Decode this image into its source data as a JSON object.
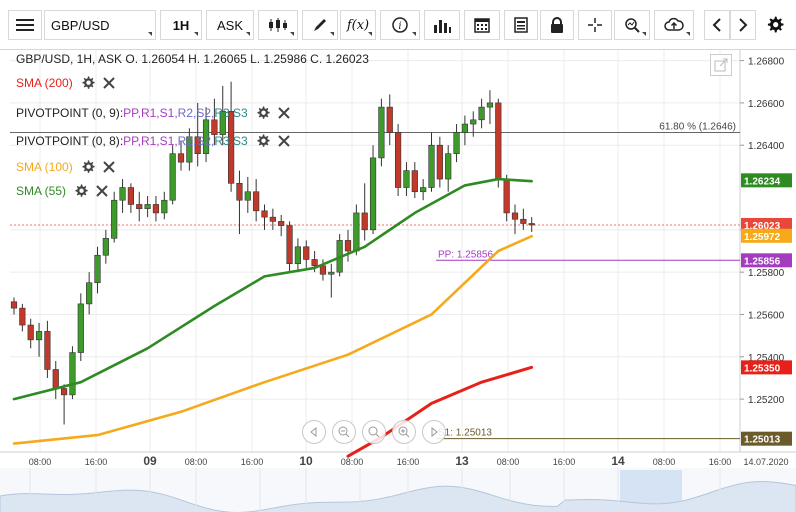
{
  "toolbar": {
    "menu_icon": "hamburger-icon",
    "symbol": "GBP/USD",
    "timeframe": "1H",
    "price_side": "ASK",
    "tools": [
      "candlestick-type-icon",
      "draw-pen-icon",
      "function-fx-icon",
      "info-icon",
      "bar-chart-icon",
      "calendar-icon",
      "news-doc-icon",
      "lock-icon",
      "crosshair-icon",
      "zoom-search-icon",
      "cloud-upload-icon",
      "chevron-left-icon",
      "chevron-right-icon",
      "gear-icon"
    ]
  },
  "ohlc_line": "GBP/USD, 1H, ASK   O. 1.26054 H. 1.26065 L. 1.25986 C. 1.26023",
  "indicators": [
    {
      "label": "SMA (200)",
      "color": "#e8201a"
    },
    {
      "label": "PIVOTPOINT (0, 9)",
      "color": "#222222",
      "levels": [
        "PP",
        "R1",
        "S1",
        "R2",
        "S2",
        "R3",
        "S3"
      ]
    },
    {
      "label": "PIVOTPOINT (0, 8)",
      "color": "#222222",
      "levels": [
        "PP",
        "R1",
        "S1",
        "R2",
        "S2",
        "R3",
        "S3"
      ]
    },
    {
      "label": "SMA (100)",
      "color": "#f5a91b"
    },
    {
      "label": "SMA (55)",
      "color": "#2e8b22"
    }
  ],
  "level_colors": {
    "PP": "#a43cc0",
    "R1": "#a43cc0",
    "S1": "#a43cc0",
    "R2": "#6b6bd0",
    "S2": "#6b6bd0",
    "R3": "#2a8a8a",
    "S3": "#2a8a8a"
  },
  "annotations": {
    "fib": "61.80 % (1.2646)",
    "pp": "PP: 1.25856",
    "s1": "S1: 1.25013"
  },
  "price_axis": {
    "ticks": [
      "1.26800",
      "1.26600",
      "1.26400",
      "1.26000",
      "1.25800",
      "1.25600",
      "1.25400",
      "1.25200"
    ],
    "badges": [
      {
        "text": "1.26234",
        "color": "#2e8b22",
        "value": 1.26234
      },
      {
        "text": "1.26023",
        "color": "#e8473a",
        "value": 1.26023
      },
      {
        "text": "1.25972",
        "color": "#f5a91b",
        "value": 1.25972
      },
      {
        "text": "1.25856",
        "color": "#a43cc0",
        "value": 1.25856
      },
      {
        "text": "1.25350",
        "color": "#e8201a",
        "value": 1.2535
      },
      {
        "text": "1.25013",
        "color": "#6b5a2a",
        "value": 1.25013
      }
    ]
  },
  "time_axis": [
    "08:00",
    "16:00",
    "09",
    "08:00",
    "16:00",
    "10",
    "08:00",
    "16:00",
    "13",
    "08:00",
    "16:00",
    "14",
    "08:00",
    "16:00",
    "14.07.2020"
  ],
  "chart_data": {
    "type": "candlestick",
    "ylim": [
      1.2495,
      1.2685
    ],
    "candles": [
      [
        1.2566,
        1.2568,
        1.256,
        1.2563
      ],
      [
        1.2563,
        1.2565,
        1.2552,
        1.2555
      ],
      [
        1.2555,
        1.2558,
        1.2544,
        1.2548
      ],
      [
        1.2548,
        1.2556,
        1.254,
        1.2552
      ],
      [
        1.2552,
        1.2557,
        1.253,
        1.2534
      ],
      [
        1.2534,
        1.2538,
        1.252,
        1.2525
      ],
      [
        1.2525,
        1.2527,
        1.2508,
        1.2522
      ],
      [
        1.2522,
        1.2545,
        1.252,
        1.2542
      ],
      [
        1.2542,
        1.257,
        1.2538,
        1.2565
      ],
      [
        1.2565,
        1.258,
        1.256,
        1.2575
      ],
      [
        1.2575,
        1.2592,
        1.257,
        1.2588
      ],
      [
        1.2588,
        1.26,
        1.2584,
        1.2596
      ],
      [
        1.2596,
        1.2618,
        1.2594,
        1.2614
      ],
      [
        1.2614,
        1.2624,
        1.2608,
        1.262
      ],
      [
        1.262,
        1.2622,
        1.2608,
        1.2612
      ],
      [
        1.2612,
        1.2618,
        1.2604,
        1.261
      ],
      [
        1.261,
        1.2616,
        1.2606,
        1.2612
      ],
      [
        1.2612,
        1.2616,
        1.2604,
        1.2608
      ],
      [
        1.2608,
        1.2618,
        1.2605,
        1.2614
      ],
      [
        1.2614,
        1.264,
        1.2612,
        1.2636
      ],
      [
        1.2636,
        1.2642,
        1.2628,
        1.2632
      ],
      [
        1.2632,
        1.2648,
        1.2628,
        1.2644
      ],
      [
        1.2644,
        1.266,
        1.263,
        1.2636
      ],
      [
        1.2636,
        1.2658,
        1.2632,
        1.2652
      ],
      [
        1.2652,
        1.2662,
        1.264,
        1.2645
      ],
      [
        1.2645,
        1.2668,
        1.264,
        1.2656
      ],
      [
        1.2656,
        1.267,
        1.2618,
        1.2622
      ],
      [
        1.2622,
        1.2628,
        1.2598,
        1.2614
      ],
      [
        1.2614,
        1.2625,
        1.2608,
        1.2618
      ],
      [
        1.2618,
        1.2624,
        1.2604,
        1.2609
      ],
      [
        1.2609,
        1.2612,
        1.26,
        1.2606
      ],
      [
        1.2606,
        1.261,
        1.26,
        1.2604
      ],
      [
        1.2604,
        1.2607,
        1.2597,
        1.2602
      ],
      [
        1.2602,
        1.2604,
        1.258,
        1.2584
      ],
      [
        1.2584,
        1.2596,
        1.258,
        1.2592
      ],
      [
        1.2592,
        1.2595,
        1.2582,
        1.2586
      ],
      [
        1.2586,
        1.259,
        1.258,
        1.2583
      ],
      [
        1.2583,
        1.2586,
        1.2576,
        1.2579
      ],
      [
        1.2579,
        1.2584,
        1.2568,
        1.258
      ],
      [
        1.258,
        1.2598,
        1.2578,
        1.2595
      ],
      [
        1.2595,
        1.26,
        1.2585,
        1.259
      ],
      [
        1.259,
        1.2612,
        1.2588,
        1.2608
      ],
      [
        1.2608,
        1.2622,
        1.2595,
        1.26
      ],
      [
        1.26,
        1.264,
        1.2598,
        1.2634
      ],
      [
        1.2634,
        1.2662,
        1.263,
        1.2658
      ],
      [
        1.2658,
        1.2664,
        1.264,
        1.2646
      ],
      [
        1.2646,
        1.265,
        1.2616,
        1.262
      ],
      [
        1.262,
        1.2632,
        1.2616,
        1.2628
      ],
      [
        1.2628,
        1.2632,
        1.2615,
        1.2618
      ],
      [
        1.2618,
        1.2624,
        1.2614,
        1.262
      ],
      [
        1.262,
        1.2646,
        1.2618,
        1.264
      ],
      [
        1.264,
        1.2644,
        1.262,
        1.2624
      ],
      [
        1.2624,
        1.264,
        1.2618,
        1.2636
      ],
      [
        1.2636,
        1.265,
        1.2632,
        1.2646
      ],
      [
        1.2646,
        1.2654,
        1.264,
        1.265
      ],
      [
        1.265,
        1.2656,
        1.2644,
        1.2652
      ],
      [
        1.2652,
        1.2662,
        1.2648,
        1.2658
      ],
      [
        1.2658,
        1.2666,
        1.265,
        1.266
      ],
      [
        1.266,
        1.2662,
        1.262,
        1.2624
      ],
      [
        1.2624,
        1.2626,
        1.2604,
        1.2608
      ],
      [
        1.2608,
        1.2612,
        1.2598,
        1.2605
      ],
      [
        1.2605,
        1.261,
        1.26,
        1.2603
      ],
      [
        1.2603,
        1.2606,
        1.2599,
        1.26023
      ]
    ],
    "series": [
      {
        "name": "SMA (55)",
        "values": [
          [
            0,
            1.252
          ],
          [
            8,
            1.2528
          ],
          [
            16,
            1.2544
          ],
          [
            24,
            1.2564
          ],
          [
            30,
            1.2578
          ],
          [
            36,
            1.2582
          ],
          [
            42,
            1.2592
          ],
          [
            48,
            1.2608
          ],
          [
            54,
            1.2621
          ],
          [
            58,
            1.2624
          ],
          [
            62,
            1.2623
          ]
        ]
      },
      {
        "name": "SMA (100)",
        "values": [
          [
            0,
            1.2499
          ],
          [
            10,
            1.2503
          ],
          [
            20,
            1.2514
          ],
          [
            30,
            1.2528
          ],
          [
            40,
            1.2541
          ],
          [
            50,
            1.256
          ],
          [
            58,
            1.259
          ],
          [
            62,
            1.2597
          ]
        ]
      },
      {
        "name": "SMA (200)",
        "values": [
          [
            40,
            1.2493
          ],
          [
            44,
            1.2502
          ],
          [
            50,
            1.2518
          ],
          [
            56,
            1.2528
          ],
          [
            62,
            1.2535
          ]
        ]
      }
    ],
    "levels": [
      {
        "name": "61.80 %",
        "value": 1.2646
      },
      {
        "name": "PP",
        "value": 1.25856
      },
      {
        "name": "S1",
        "value": 1.25013
      },
      {
        "name": "last",
        "value": 1.26023
      }
    ]
  }
}
